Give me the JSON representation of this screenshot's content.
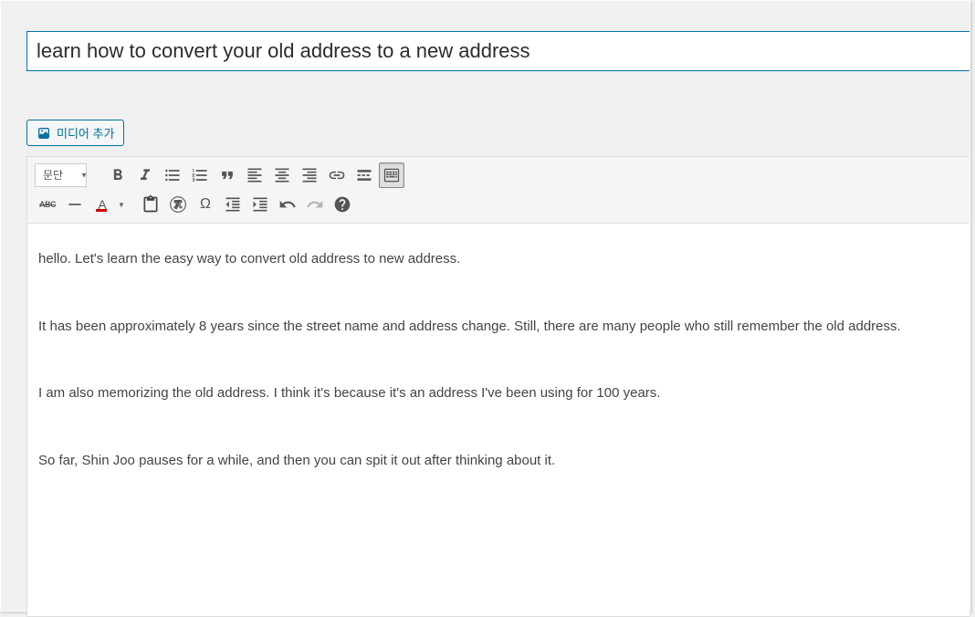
{
  "title": {
    "value": "learn how to convert your old address to a new address"
  },
  "media_button": {
    "label": "미디어 추가"
  },
  "toolbar": {
    "format_dropdown": "문단"
  },
  "content": {
    "paragraphs": [
      "hello. Let's learn the easy way to convert old address to new address.",
      "It has been approximately 8 years since the street name and address change. Still, there are many people who still remember the old address.",
      "I am also memorizing the old address. I think it's because it's an address I've been using for 100 years.",
      "So far, Shin Joo pauses for a while, and then you can spit it out after thinking about it."
    ]
  }
}
